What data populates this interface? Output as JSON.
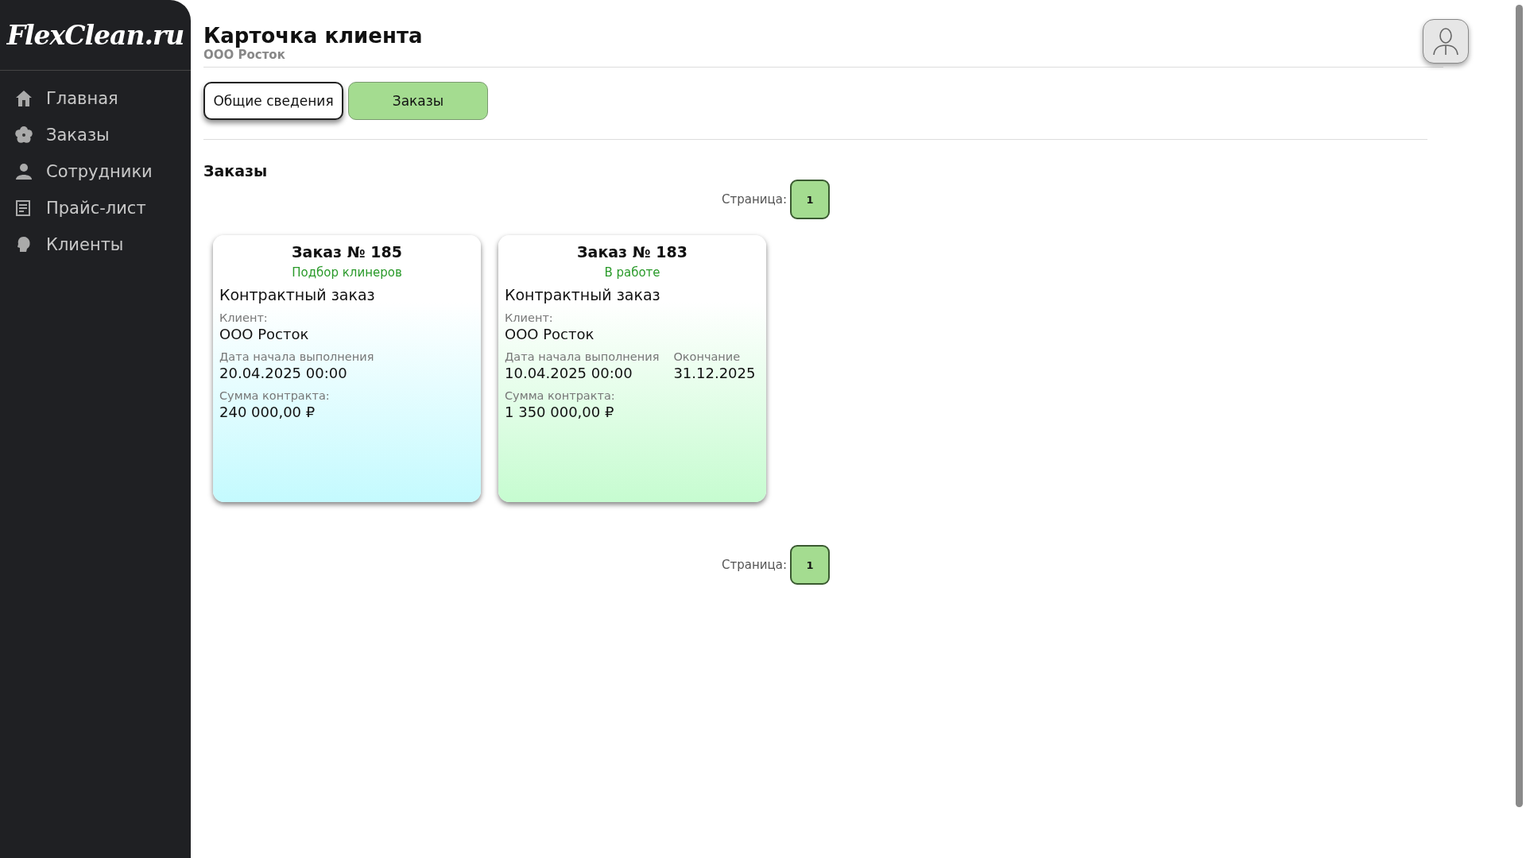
{
  "sidebar": {
    "logo": "FlexClean.ru",
    "items": [
      {
        "kind": "home",
        "label": "Главная",
        "selected": false
      },
      {
        "kind": "orders",
        "label": "Заказы",
        "selected": false
      },
      {
        "kind": "staff",
        "label": "Сотрудники",
        "selected": false
      },
      {
        "kind": "price",
        "label": "Прайс-лист",
        "selected": false
      },
      {
        "kind": "clients",
        "label": "Клиенты",
        "selected": false
      }
    ]
  },
  "header": {
    "title": "Карточка клиента",
    "subtitle": "ООО Росток"
  },
  "tabs": [
    {
      "label": "Общие сведения",
      "selected": false
    },
    {
      "label": "Заказы",
      "selected": true
    }
  ],
  "section_title": "Заказы",
  "pagination_top": {
    "label": "Страница:",
    "pages": [
      {
        "label": "1",
        "selected": true
      }
    ]
  },
  "orders": [
    {
      "title": "Заказ № 185",
      "status": "Подбор клинеров",
      "color": "#c4fafe",
      "type": "Контрактный заказ",
      "client_label": "Клиент:",
      "client": "ООО Росток",
      "start_label": "Дата начала выполнения",
      "start": "20.04.2025 00:00",
      "sum_label": "Сумма контракта:",
      "sum": "240 000,00 ₽"
    },
    {
      "title": "Заказ № 183",
      "status": "В работе",
      "color": "#c6fcd0",
      "type": "Контрактный заказ",
      "client_label": "Клиент:",
      "client": "ООО Росток",
      "start_label": "Дата начала выполнения",
      "start": "10.04.2025 00:00",
      "end_label": "Окончание",
      "end": "31.12.2025",
      "sum_label": "Сумма контракта:",
      "sum": "1 350 000,00 ₽"
    }
  ],
  "pagination_bottom": {
    "label": "Страница:",
    "pages": [
      {
        "label": "1",
        "selected": true
      }
    ]
  }
}
